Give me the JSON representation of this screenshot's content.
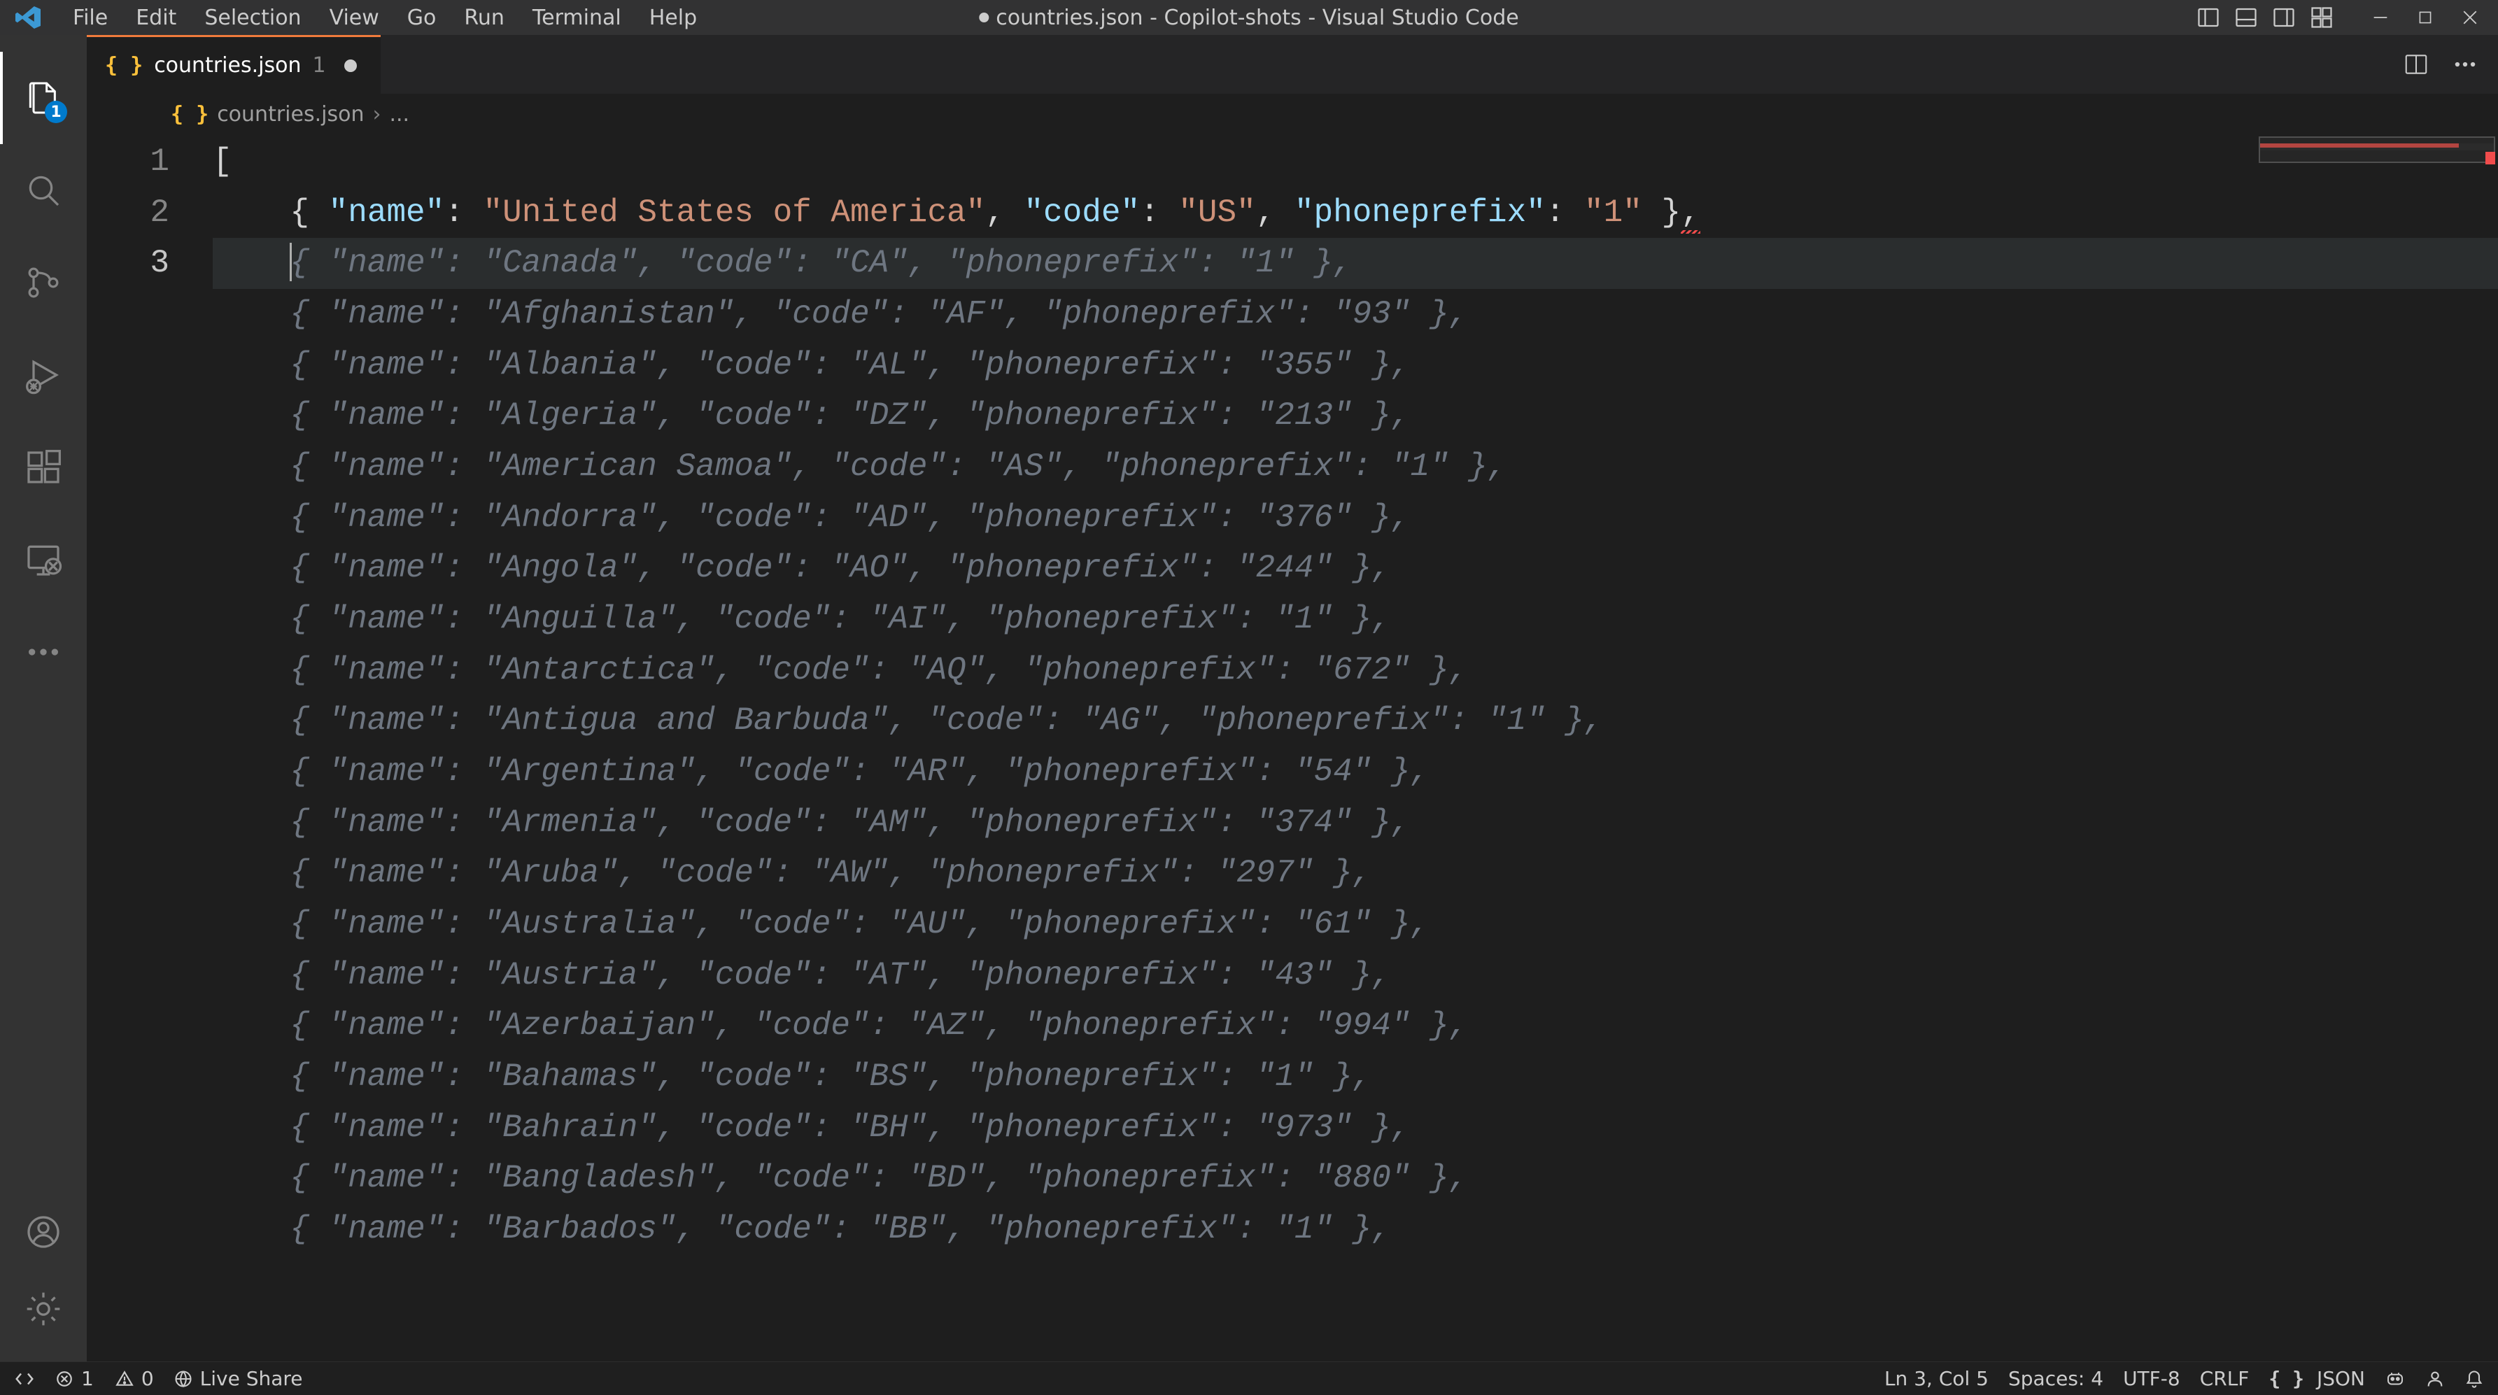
{
  "menu": [
    "File",
    "Edit",
    "Selection",
    "View",
    "Go",
    "Run",
    "Terminal",
    "Help"
  ],
  "window_title": "countries.json - Copilot-shots - Visual Studio Code",
  "tab": {
    "name": "countries.json",
    "problems": "1",
    "dirty": true
  },
  "breadcrumb": {
    "file": "countries.json",
    "rest": "..."
  },
  "activity": {
    "explorer_badge": "1"
  },
  "editor": {
    "line_numbers": [
      "1",
      "2",
      "3"
    ],
    "open_bracket": "[",
    "real_row": {
      "name": "United States of America",
      "code": "US",
      "phoneprefix": "1"
    },
    "ghost_rows": [
      {
        "name": "Canada",
        "code": "CA",
        "phoneprefix": "1"
      },
      {
        "name": "Afghanistan",
        "code": "AF",
        "phoneprefix": "93"
      },
      {
        "name": "Albania",
        "code": "AL",
        "phoneprefix": "355"
      },
      {
        "name": "Algeria",
        "code": "DZ",
        "phoneprefix": "213"
      },
      {
        "name": "American Samoa",
        "code": "AS",
        "phoneprefix": "1"
      },
      {
        "name": "Andorra",
        "code": "AD",
        "phoneprefix": "376"
      },
      {
        "name": "Angola",
        "code": "AO",
        "phoneprefix": "244"
      },
      {
        "name": "Anguilla",
        "code": "AI",
        "phoneprefix": "1"
      },
      {
        "name": "Antarctica",
        "code": "AQ",
        "phoneprefix": "672"
      },
      {
        "name": "Antigua and Barbuda",
        "code": "AG",
        "phoneprefix": "1"
      },
      {
        "name": "Argentina",
        "code": "AR",
        "phoneprefix": "54"
      },
      {
        "name": "Armenia",
        "code": "AM",
        "phoneprefix": "374"
      },
      {
        "name": "Aruba",
        "code": "AW",
        "phoneprefix": "297"
      },
      {
        "name": "Australia",
        "code": "AU",
        "phoneprefix": "61"
      },
      {
        "name": "Austria",
        "code": "AT",
        "phoneprefix": "43"
      },
      {
        "name": "Azerbaijan",
        "code": "AZ",
        "phoneprefix": "994"
      },
      {
        "name": "Bahamas",
        "code": "BS",
        "phoneprefix": "1"
      },
      {
        "name": "Bahrain",
        "code": "BH",
        "phoneprefix": "973"
      },
      {
        "name": "Bangladesh",
        "code": "BD",
        "phoneprefix": "880"
      },
      {
        "name": "Barbados",
        "code": "BB",
        "phoneprefix": "1"
      }
    ]
  },
  "statusbar": {
    "errors": "1",
    "warnings": "0",
    "liveshare": "Live Share",
    "cursor": "Ln 3, Col 5",
    "spaces": "Spaces: 4",
    "encoding": "UTF-8",
    "eol": "CRLF",
    "lang": "JSON"
  }
}
